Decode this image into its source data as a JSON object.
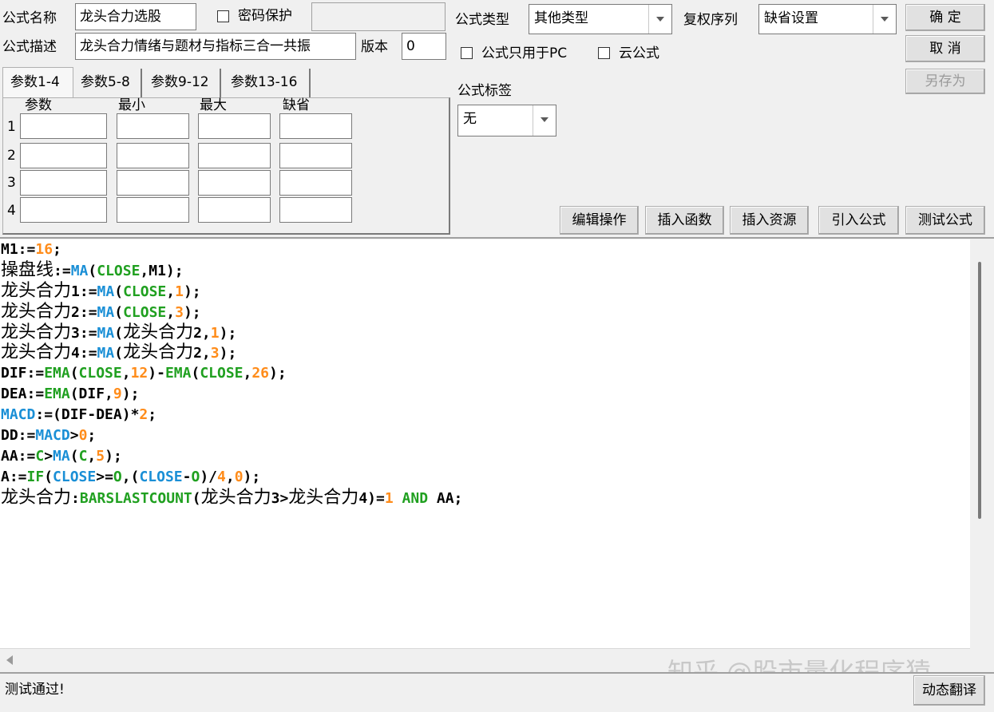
{
  "header": {
    "name_label": "公式名称",
    "name_value": "龙头合力选股",
    "password_label": "密码保护",
    "password_checked": false,
    "desc_label": "公式描述",
    "desc_value": "龙头合力情绪与题材与指标三合一共振",
    "version_label": "版本",
    "version_value": "0",
    "type_label": "公式类型",
    "type_value": "其他类型",
    "rights_label": "复权序列",
    "rights_value": "缺省设置",
    "pc_only_label": "公式只用于PC",
    "pc_only_checked": false,
    "cloud_label": "云公式",
    "cloud_checked": false,
    "tag_label": "公式标签",
    "tag_value": "无"
  },
  "buttons": {
    "ok": "确 定",
    "cancel": "取 消",
    "save_as": "另存为",
    "edit_ops": "编辑操作",
    "insert_func": "插入函数",
    "insert_res": "插入资源",
    "import_formula": "引入公式",
    "test_formula": "测试公式",
    "dynamic_translate": "动态翻译"
  },
  "params": {
    "tabs": [
      "参数1-4",
      "参数5-8",
      "参数9-12",
      "参数13-16"
    ],
    "active_tab": 0,
    "columns": [
      "参数",
      "最小",
      "最大",
      "缺省"
    ],
    "rows": [
      "1",
      "2",
      "3",
      "4"
    ]
  },
  "code_lines": [
    [
      [
        "M1:=",
        "txt"
      ],
      [
        "16",
        "num"
      ],
      [
        ";",
        "txt"
      ]
    ],
    [
      [
        "操盘线",
        "cjk"
      ],
      [
        ":=",
        "txt"
      ],
      [
        "MA",
        "fn"
      ],
      [
        "(",
        "txt"
      ],
      [
        "CLOSE",
        "var"
      ],
      [
        ",M1);",
        "txt"
      ]
    ],
    [
      [
        "龙头合力",
        "cjk"
      ],
      [
        "1:=",
        "txt"
      ],
      [
        "MA",
        "fn"
      ],
      [
        "(",
        "txt"
      ],
      [
        "CLOSE",
        "var"
      ],
      [
        ",",
        "txt"
      ],
      [
        "1",
        "num"
      ],
      [
        ");",
        "txt"
      ]
    ],
    [
      [
        "龙头合力",
        "cjk"
      ],
      [
        "2:=",
        "txt"
      ],
      [
        "MA",
        "fn"
      ],
      [
        "(",
        "txt"
      ],
      [
        "CLOSE",
        "var"
      ],
      [
        ",",
        "txt"
      ],
      [
        "3",
        "num"
      ],
      [
        ");",
        "txt"
      ]
    ],
    [
      [
        "龙头合力",
        "cjk"
      ],
      [
        "3:=",
        "txt"
      ],
      [
        "MA",
        "fn"
      ],
      [
        "(",
        "txt"
      ],
      [
        "龙头合力",
        "cjk"
      ],
      [
        "2,",
        "txt"
      ],
      [
        "1",
        "num"
      ],
      [
        ");",
        "txt"
      ]
    ],
    [
      [
        "龙头合力",
        "cjk"
      ],
      [
        "4:=",
        "txt"
      ],
      [
        "MA",
        "fn"
      ],
      [
        "(",
        "txt"
      ],
      [
        "龙头合力",
        "cjk"
      ],
      [
        "2,",
        "txt"
      ],
      [
        "3",
        "num"
      ],
      [
        ");",
        "txt"
      ]
    ],
    [
      [
        "DIF:=",
        "txt"
      ],
      [
        "EMA",
        "var"
      ],
      [
        "(",
        "txt"
      ],
      [
        "CLOSE",
        "var"
      ],
      [
        ",",
        "txt"
      ],
      [
        "12",
        "num"
      ],
      [
        ")-",
        "txt"
      ],
      [
        "EMA",
        "var"
      ],
      [
        "(",
        "txt"
      ],
      [
        "CLOSE",
        "var"
      ],
      [
        ",",
        "txt"
      ],
      [
        "26",
        "num"
      ],
      [
        ");",
        "txt"
      ]
    ],
    [
      [
        "DEA:=",
        "txt"
      ],
      [
        "EMA",
        "var"
      ],
      [
        "(DIF,",
        "txt"
      ],
      [
        "9",
        "num"
      ],
      [
        ");",
        "txt"
      ]
    ],
    [
      [
        "MACD",
        "fn"
      ],
      [
        ":=(DIF-DEA)*",
        "txt"
      ],
      [
        "2",
        "num"
      ],
      [
        ";",
        "txt"
      ]
    ],
    [
      [
        "DD:=",
        "txt"
      ],
      [
        "MACD",
        "fn"
      ],
      [
        ">",
        "txt"
      ],
      [
        "0",
        "num"
      ],
      [
        ";",
        "txt"
      ]
    ],
    [
      [
        "AA:=",
        "txt"
      ],
      [
        "C",
        "var"
      ],
      [
        ">",
        "txt"
      ],
      [
        "MA",
        "fn"
      ],
      [
        "(",
        "txt"
      ],
      [
        "C",
        "var"
      ],
      [
        ",",
        "txt"
      ],
      [
        "5",
        "num"
      ],
      [
        ");",
        "txt"
      ]
    ],
    [
      [
        "A:=",
        "txt"
      ],
      [
        "IF",
        "var"
      ],
      [
        "(",
        "txt"
      ],
      [
        "CLOSE",
        "fn"
      ],
      [
        ">=",
        "txt"
      ],
      [
        "O",
        "var"
      ],
      [
        ",(",
        "txt"
      ],
      [
        "CLOSE",
        "fn"
      ],
      [
        "-",
        "txt"
      ],
      [
        "O",
        "var"
      ],
      [
        ")/",
        "txt"
      ],
      [
        "4",
        "num"
      ],
      [
        ",",
        "txt"
      ],
      [
        "0",
        "num"
      ],
      [
        ");",
        "txt"
      ]
    ],
    [
      [
        "龙头合力",
        "cjk"
      ],
      [
        ":",
        "txt"
      ],
      [
        "BARSLASTCOUNT",
        "var"
      ],
      [
        "(",
        "txt"
      ],
      [
        "龙头合力",
        "cjk"
      ],
      [
        "3>",
        "txt"
      ],
      [
        "龙头合力",
        "cjk"
      ],
      [
        "4)=",
        "txt"
      ],
      [
        "1",
        "num"
      ],
      [
        " ",
        "txt"
      ],
      [
        "AND",
        "var"
      ],
      [
        " AA;",
        "txt"
      ]
    ]
  ],
  "status": {
    "message": "测试通过!"
  },
  "watermark": "知乎 @股市量化程序猿",
  "colors": {
    "number": "#ff8c1a",
    "function": "#1a8fd6",
    "variable": "#20a020"
  }
}
